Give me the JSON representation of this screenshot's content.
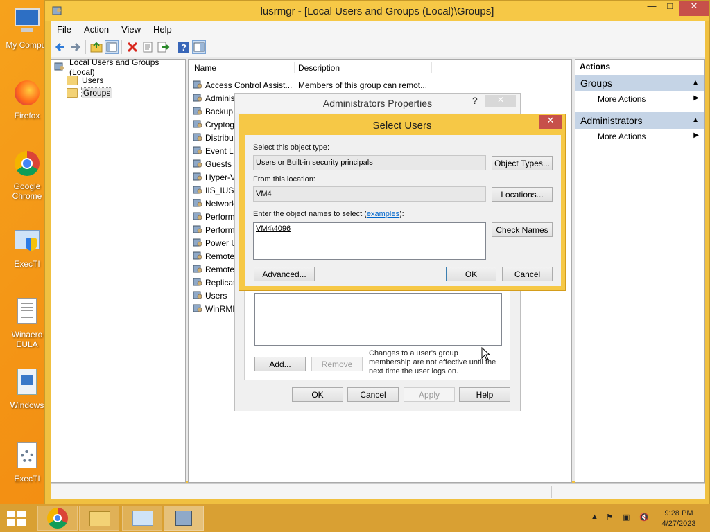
{
  "desktop": {
    "icons": [
      {
        "label": "My Comput"
      },
      {
        "label": "Firefox"
      },
      {
        "label": "Google Chrome"
      },
      {
        "label": "ExecTI"
      },
      {
        "label": "Winaero EULA"
      },
      {
        "label": "Windows"
      },
      {
        "label": "ExecTI"
      }
    ]
  },
  "window": {
    "title": "lusrmgr - [Local Users and Groups (Local)\\Groups]",
    "min": "—",
    "max": "□",
    "close": "✕"
  },
  "menu": [
    "File",
    "Action",
    "View",
    "Help"
  ],
  "tree": {
    "root": "Local Users and Groups (Local)",
    "children": [
      "Users",
      "Groups"
    ]
  },
  "list": {
    "columns": [
      "Name",
      "Description"
    ],
    "rows": [
      {
        "name": "Access Control Assist...",
        "desc": "Members of this group can remot..."
      },
      {
        "name": "Adminis",
        "desc": ""
      },
      {
        "name": "Backup",
        "desc": ""
      },
      {
        "name": "Cryptog",
        "desc": ""
      },
      {
        "name": "Distribu",
        "desc": ""
      },
      {
        "name": "Event Lo",
        "desc": ""
      },
      {
        "name": "Guests",
        "desc": ""
      },
      {
        "name": "Hyper-V",
        "desc": ""
      },
      {
        "name": "IIS_IUSR",
        "desc": ""
      },
      {
        "name": "Network",
        "desc": ""
      },
      {
        "name": "Perform",
        "desc": ""
      },
      {
        "name": "Perform",
        "desc": ""
      },
      {
        "name": "Power U",
        "desc": ""
      },
      {
        "name": "Remote",
        "desc": ""
      },
      {
        "name": "Remote",
        "desc": ""
      },
      {
        "name": "Replicat",
        "desc": ""
      },
      {
        "name": "Users",
        "desc": ""
      },
      {
        "name": "WinRMR",
        "desc": ""
      }
    ]
  },
  "actions": {
    "title": "Actions",
    "sections": [
      {
        "head": "Groups",
        "item": "More Actions"
      },
      {
        "head": "Administrators",
        "item": "More Actions"
      }
    ]
  },
  "props_dialog": {
    "title": "Administrators Properties",
    "help": "?",
    "close": "✕",
    "note": "Changes to a user's group membership are not effective until the next time the user logs on.",
    "add": "Add...",
    "remove": "Remove",
    "ok": "OK",
    "cancel": "Cancel",
    "apply": "Apply",
    "help_btn": "Help"
  },
  "select_dialog": {
    "title": "Select Users",
    "close": "✕",
    "object_type_label": "Select this object type:",
    "object_type_value": "Users or Built-in security principals",
    "object_types_btn": "Object Types...",
    "location_label": "From this location:",
    "location_value": "VM4",
    "locations_btn": "Locations...",
    "names_label_pre": "Enter the object names to select (",
    "names_label_link": "examples",
    "names_label_post": "):",
    "names_value": "VM4\\4096",
    "check_names_btn": "Check Names",
    "advanced_btn": "Advanced...",
    "ok_btn": "OK",
    "cancel_btn": "Cancel"
  },
  "taskbar": {
    "time": "9:28 PM",
    "date": "4/27/2023"
  }
}
